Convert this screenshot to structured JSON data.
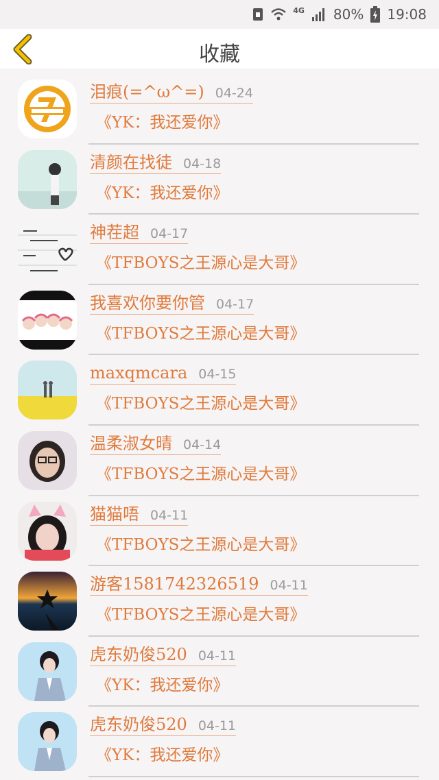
{
  "status_bar": {
    "network": "4G",
    "battery": "80%",
    "time": "19:08"
  },
  "header": {
    "title": "收藏"
  },
  "items": [
    {
      "user": "泪痕(=^ω^=)",
      "date": "04-24",
      "title": "《YK：我还爱你》",
      "avatar": "tfboys-logo"
    },
    {
      "user": "清颜在找徒",
      "date": "04-18",
      "title": "《YK：我还爱你》",
      "avatar": "girl-photo"
    },
    {
      "user": "神茬超",
      "date": "04-17",
      "title": "《TFBOYS之王源心是大哥》",
      "avatar": "handwriting-heart"
    },
    {
      "user": "我喜欢你要你管",
      "date": "04-17",
      "title": "《TFBOYS之王源心是大哥》",
      "avatar": "cartoon-group"
    },
    {
      "user": "maxqmcara",
      "date": "04-15",
      "title": "《TFBOYS之王源心是大哥》",
      "avatar": "field-couple"
    },
    {
      "user": "温柔淑女晴",
      "date": "04-14",
      "title": "《TFBOYS之王源心是大哥》",
      "avatar": "girl-glasses"
    },
    {
      "user": "猫猫唔",
      "date": "04-11",
      "title": "《TFBOYS之王源心是大哥》",
      "avatar": "cat-ears-girl"
    },
    {
      "user": "游客1581742326519",
      "date": "04-11",
      "title": "《TFBOYS之王源心是大哥》",
      "avatar": "sunset-star"
    },
    {
      "user": "虎东奶俊520",
      "date": "04-11",
      "title": "《YK：我还爱你》",
      "avatar": "boy-blue"
    },
    {
      "user": "虎东奶俊520",
      "date": "04-11",
      "title": "《YK：我还爱你》",
      "avatar": "boy-blue"
    }
  ],
  "colors": {
    "accent": "#e07a3c",
    "back_arrow": "#f2c200",
    "date": "#9b9b9b",
    "background": "#f6f4f4"
  }
}
